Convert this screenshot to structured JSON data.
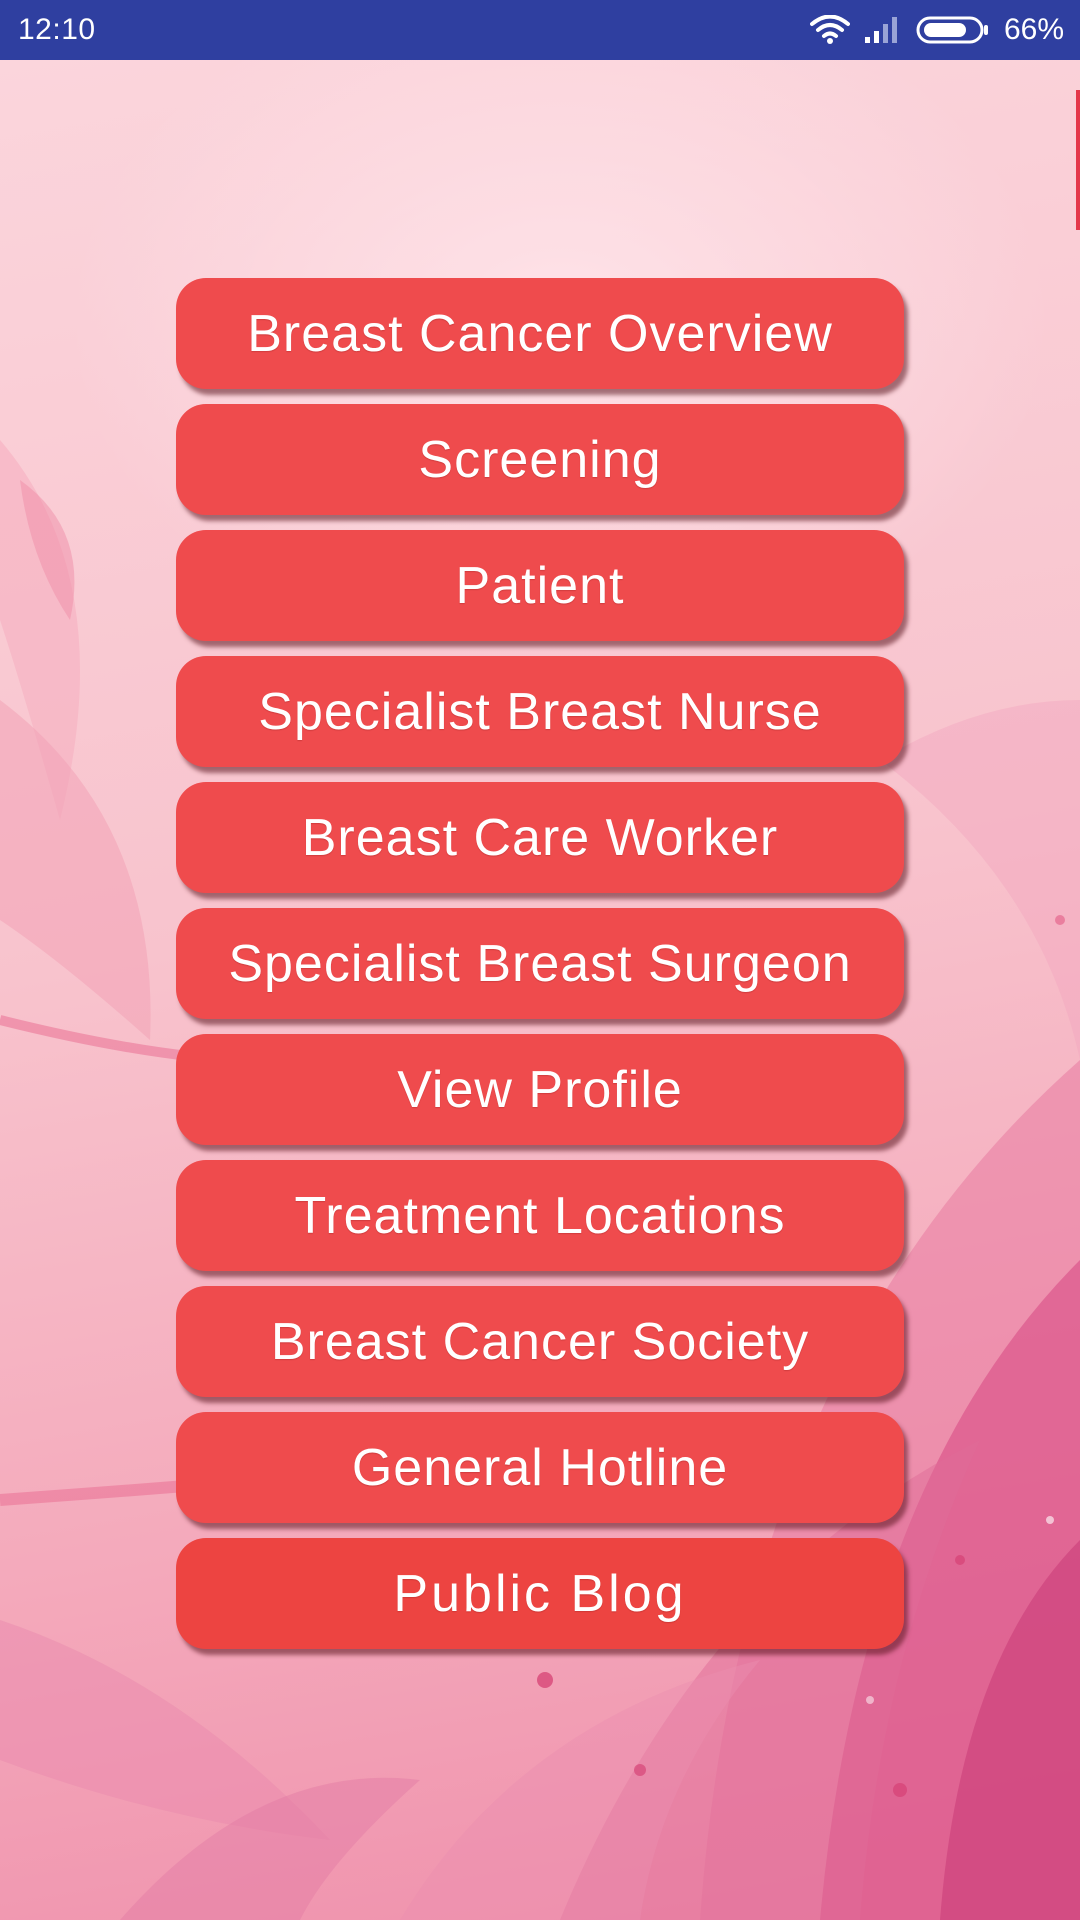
{
  "status_bar": {
    "time": "12:10",
    "battery_percent": "66%",
    "icons": [
      "wifi-icon",
      "signal-icon",
      "battery-icon"
    ],
    "background_color": "#2f3fa0"
  },
  "menu": {
    "button_color": "#ef4b4d",
    "items": [
      {
        "label": "Breast Cancer Overview"
      },
      {
        "label": "Screening"
      },
      {
        "label": "Patient"
      },
      {
        "label": "Specialist Breast Nurse"
      },
      {
        "label": "Breast Care Worker"
      },
      {
        "label": "Specialist Breast Surgeon"
      },
      {
        "label": "View Profile"
      },
      {
        "label": "Treatment Locations"
      },
      {
        "label": "Breast Cancer Society"
      },
      {
        "label": "General Hotline"
      },
      {
        "label": "Public Blog"
      }
    ]
  }
}
